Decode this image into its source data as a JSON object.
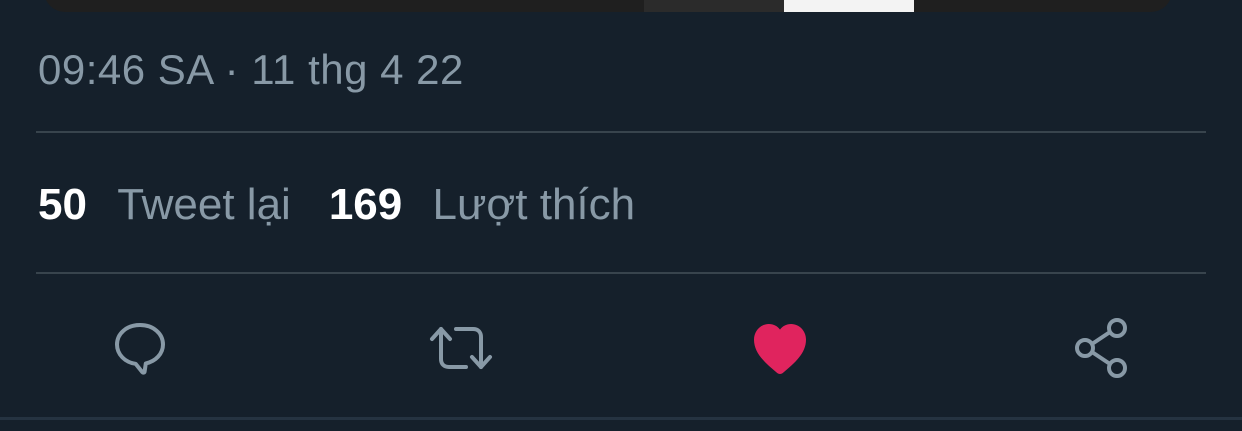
{
  "tweet": {
    "timestamp": "09:46 SA · 11 thg 4 22"
  },
  "stats": {
    "retweets_count": "50",
    "retweets_label": "Tweet lại",
    "likes_count": "169",
    "likes_label": "Lượt thích"
  },
  "actions": [
    {
      "name": "reply",
      "icon": "reply-icon"
    },
    {
      "name": "retweet",
      "icon": "retweet-icon"
    },
    {
      "name": "like",
      "icon": "heart-icon",
      "liked": true
    },
    {
      "name": "share",
      "icon": "share-icon"
    }
  ],
  "colors": {
    "background": "#15202b",
    "divider": "#38444d",
    "secondary_text": "#8899a6",
    "primary_text": "#ffffff",
    "icon": "#8899a6",
    "like_active": "#e0245e"
  }
}
